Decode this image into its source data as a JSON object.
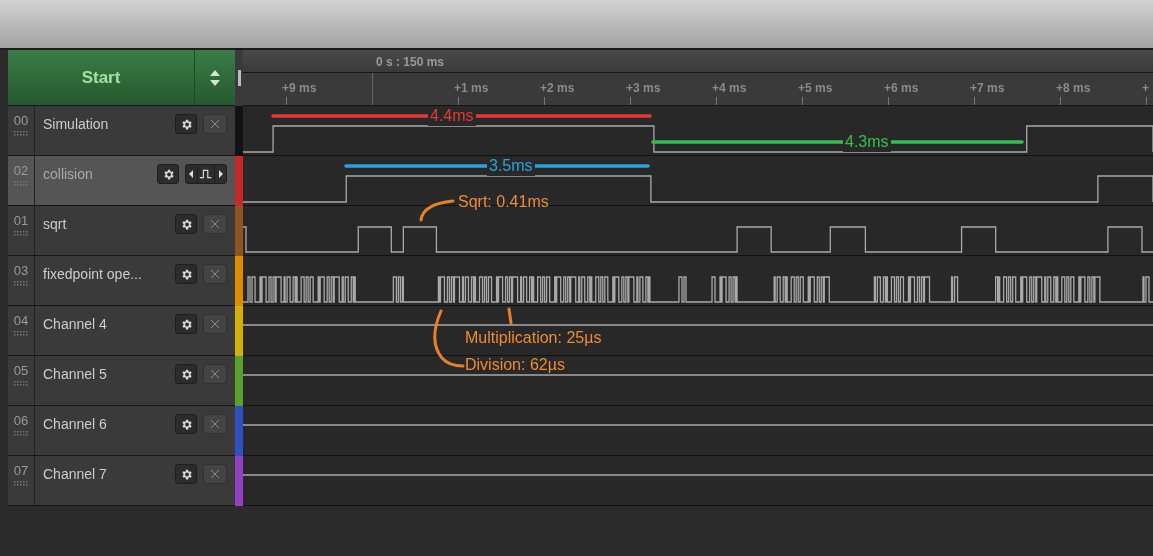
{
  "start_button": {
    "label": "Start"
  },
  "timeline": {
    "position": "0 s : 150 ms",
    "ticks": [
      "+9 ms",
      "+1 ms",
      "+2 ms",
      "+3 ms",
      "+4 ms",
      "+5 ms",
      "+6 ms",
      "+7 ms",
      "+8 ms",
      "+"
    ]
  },
  "channels": [
    {
      "number": "00",
      "name": "Simulation",
      "selected": false,
      "kind": "closable",
      "color": "#121212"
    },
    {
      "number": "02",
      "name": "collision",
      "selected": true,
      "kind": "trigger",
      "color": "#c62828"
    },
    {
      "number": "01",
      "name": "sqrt",
      "selected": false,
      "kind": "closable",
      "color": "#8d5524"
    },
    {
      "number": "03",
      "name": "fixedpoint ope...",
      "selected": false,
      "kind": "closable",
      "color": "#e08a00"
    },
    {
      "number": "04",
      "name": "Channel 4",
      "selected": false,
      "kind": "closable",
      "color": "#d4b000"
    },
    {
      "number": "05",
      "name": "Channel 5",
      "selected": false,
      "kind": "closable",
      "color": "#5aa02c"
    },
    {
      "number": "06",
      "name": "Channel 6",
      "selected": false,
      "kind": "closable",
      "color": "#3050c0"
    },
    {
      "number": "07",
      "name": "Channel 7",
      "selected": false,
      "kind": "closable",
      "color": "#9040c0"
    }
  ],
  "measurements": [
    {
      "label": "4.4ms",
      "color": "#e53935"
    },
    {
      "label": "3.5ms",
      "color": "#29a3e0"
    },
    {
      "label": "4.3ms",
      "color": "#2ec24a"
    }
  ],
  "notes": [
    {
      "text": "Sqrt: 0.41ms"
    },
    {
      "text": "Multiplication: 25µs"
    },
    {
      "text": "Division: 62µs"
    }
  ]
}
